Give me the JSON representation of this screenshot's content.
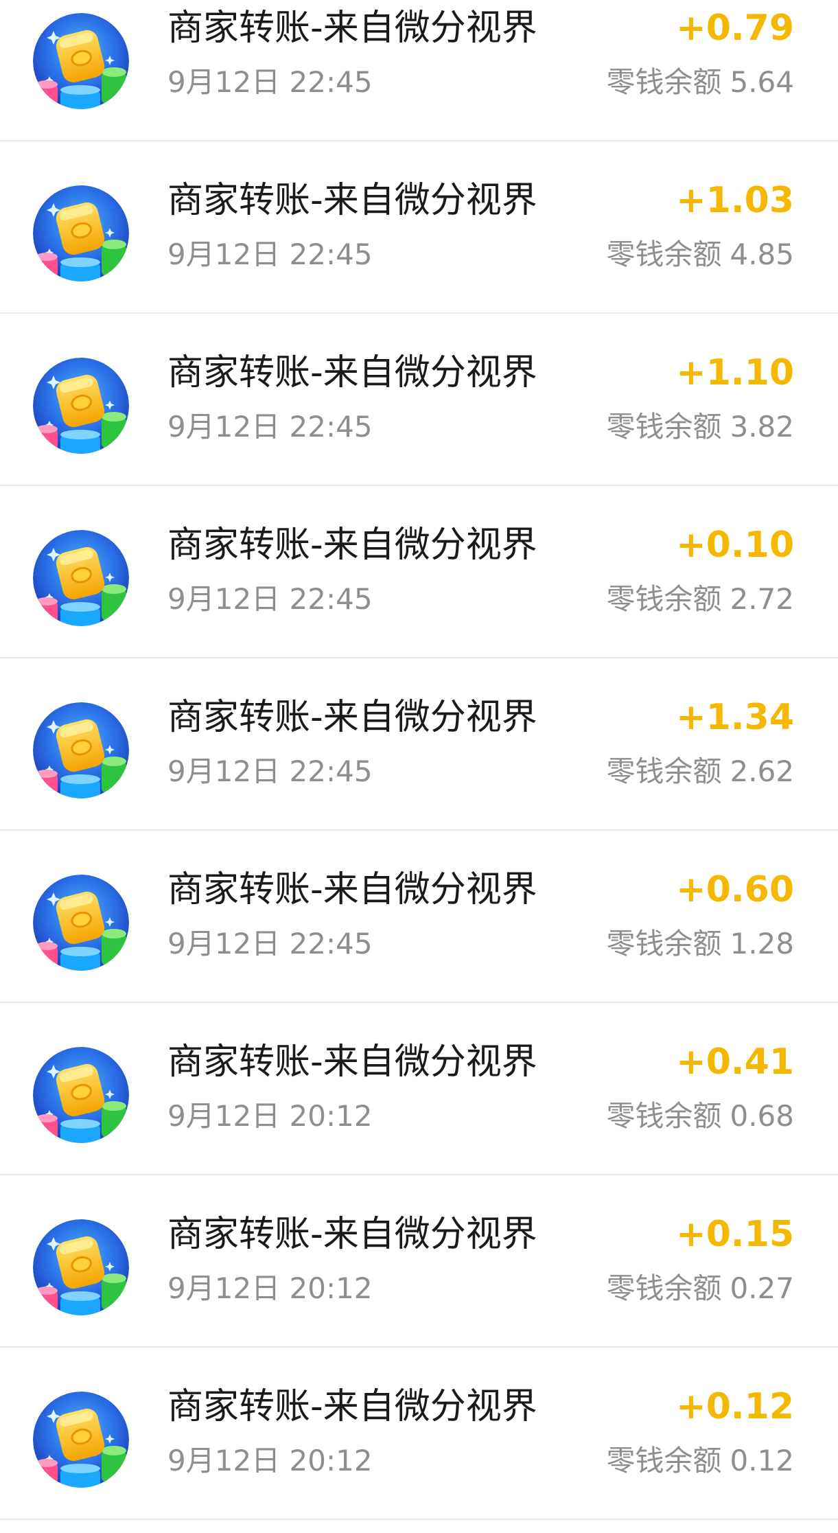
{
  "transactions": [
    {
      "title": "商家转账-来自微分视界",
      "time": "9月12日 22:45",
      "amount": "+0.79",
      "balance_label": "零钱余额",
      "balance": "5.64"
    },
    {
      "title": "商家转账-来自微分视界",
      "time": "9月12日 22:45",
      "amount": "+1.03",
      "balance_label": "零钱余额",
      "balance": "4.85"
    },
    {
      "title": "商家转账-来自微分视界",
      "time": "9月12日 22:45",
      "amount": "+1.10",
      "balance_label": "零钱余额",
      "balance": "3.82"
    },
    {
      "title": "商家转账-来自微分视界",
      "time": "9月12日 22:45",
      "amount": "+0.10",
      "balance_label": "零钱余额",
      "balance": "2.72"
    },
    {
      "title": "商家转账-来自微分视界",
      "time": "9月12日 22:45",
      "amount": "+1.34",
      "balance_label": "零钱余额",
      "balance": "2.62"
    },
    {
      "title": "商家转账-来自微分视界",
      "time": "9月12日 22:45",
      "amount": "+0.60",
      "balance_label": "零钱余额",
      "balance": "1.28"
    },
    {
      "title": "商家转账-来自微分视界",
      "time": "9月12日 20:12",
      "amount": "+0.41",
      "balance_label": "零钱余额",
      "balance": "0.68"
    },
    {
      "title": "商家转账-来自微分视界",
      "time": "9月12日 20:12",
      "amount": "+0.15",
      "balance_label": "零钱余额",
      "balance": "0.27"
    },
    {
      "title": "商家转账-来自微分视界",
      "time": "9月12日 20:12",
      "amount": "+0.12",
      "balance_label": "零钱余额",
      "balance": "0.12"
    }
  ],
  "colors": {
    "amount_positive": "#f5b800",
    "title_text": "#1a1a1a",
    "secondary_text": "#8e8e8e",
    "divider": "#ebebeb"
  },
  "icons": {
    "merchant_avatar": "coin-stack-app-icon"
  }
}
